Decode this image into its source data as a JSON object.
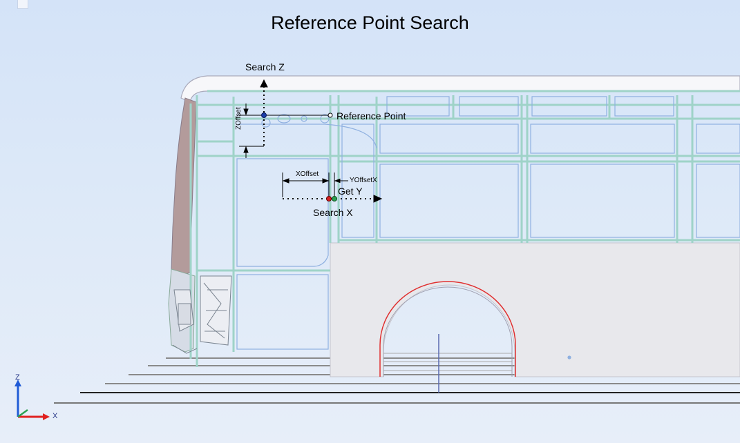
{
  "title": "Reference Point Search",
  "labels": {
    "search_z": "Search Z",
    "reference_point": "Reference Point",
    "z_offset": "ZOffset",
    "x_offset": "XOffset",
    "y_offset_x": "YOffsetX",
    "get_y": "Get Y",
    "search_x": "Search X"
  },
  "axes": {
    "z": "Z",
    "x": "X"
  },
  "colors": {
    "background": "#d4e3f8",
    "frame": "#9fd3c8",
    "panel": "#e8e8ec",
    "curtain": "#b39b9b",
    "reference_point_marker": "#1c3da8",
    "search_x_marker": "#d42020",
    "get_y_marker": "#2aa050",
    "axis_z": "#1f5bd6",
    "axis_x": "#e02020",
    "wheel_arch": "#e03030"
  },
  "icons": [
    "window-tab-icon"
  ]
}
